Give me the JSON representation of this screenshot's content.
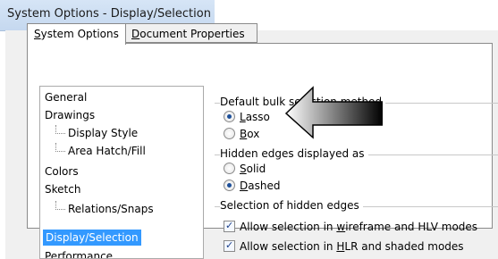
{
  "window": {
    "title": "System Options - Display/Selection"
  },
  "tabs": [
    {
      "label": "System Options",
      "mnemonic": "S",
      "active": true
    },
    {
      "label": "Document Properties",
      "mnemonic": "D",
      "active": false
    }
  ],
  "tree": {
    "items": [
      {
        "label": "General",
        "level": 0
      },
      {
        "label": "Drawings",
        "level": 0
      },
      {
        "label": "Display Style",
        "level": 1
      },
      {
        "label": "Area Hatch/Fill",
        "level": 1
      },
      {
        "label": "Colors",
        "level": 0
      },
      {
        "label": "Sketch",
        "level": 0
      },
      {
        "label": "Relations/Snaps",
        "level": 1
      },
      {
        "label": "Display/Selection",
        "level": 0,
        "selected": true
      },
      {
        "label": "Performance",
        "level": 0
      }
    ]
  },
  "groups": {
    "default_bulk": {
      "title": "Default bulk selection method",
      "options": [
        {
          "label": "Lasso",
          "mnemonic": "L",
          "selected": true
        },
        {
          "label": "Box",
          "mnemonic": "B",
          "selected": false
        }
      ]
    },
    "hidden_edges": {
      "title": "Hidden edges displayed as",
      "options": [
        {
          "label": "Solid",
          "mnemonic": "S",
          "selected": false
        },
        {
          "label": "Dashed",
          "mnemonic": "D",
          "selected": true
        }
      ]
    },
    "selection_hidden": {
      "title": "Selection of hidden edges",
      "options": [
        {
          "pre": "Allow selection in ",
          "mn": "w",
          "post": "ireframe and HLV modes",
          "checked": true
        },
        {
          "pre": "Allow selection in ",
          "mn": "H",
          "post": "LR and shaded modes",
          "checked": true
        }
      ]
    }
  },
  "colors": {
    "selection_highlight": "#3399ff",
    "titlebar": "#c5d8ef",
    "radio_dot": "#1d4f99"
  },
  "annotation": {
    "icon": "callout-arrow-icon",
    "points_to": "Lasso"
  }
}
